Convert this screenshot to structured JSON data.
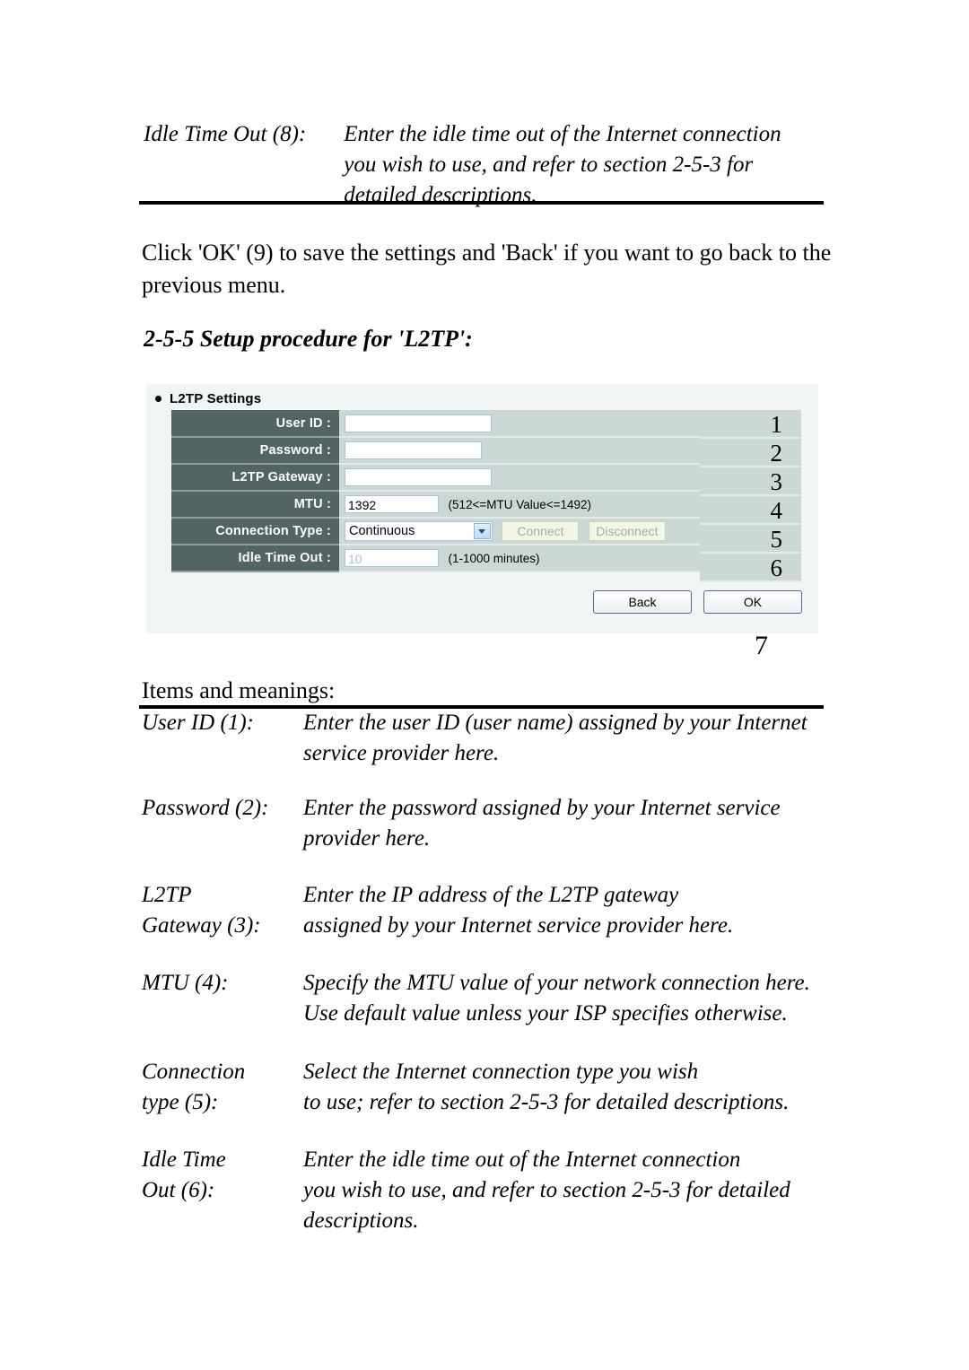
{
  "top_definition": {
    "term": "Idle Time Out (8):",
    "desc_lines": [
      "Enter the idle time out of the Internet connection",
      "you wish to use, and refer to section 2-5-3 for",
      "detailed descriptions."
    ]
  },
  "paragraph": {
    "lines": [
      "Click 'OK' (9) to save the settings and 'Back' if you want to go back to the",
      "previous menu."
    ]
  },
  "heading": "2-5-5 Setup procedure for 'L2TP':",
  "panel": {
    "title": "L2TP Settings",
    "rows": [
      {
        "label": "User ID :",
        "control": "text",
        "value": "",
        "hint": "",
        "annotation": "1"
      },
      {
        "label": "Password :",
        "control": "text",
        "value": "",
        "hint": "",
        "annotation": "2"
      },
      {
        "label": "L2TP Gateway :",
        "control": "text",
        "value": "",
        "hint": "",
        "annotation": "3"
      },
      {
        "label": "MTU :",
        "control": "text",
        "value": "1392",
        "hint": "(512<=MTU Value<=1492)",
        "annotation": "4"
      },
      {
        "label": "Connection Type :",
        "control": "select",
        "value": "Continuous",
        "hint": "",
        "annotation": "5"
      },
      {
        "label": "Idle Time Out :",
        "control": "text",
        "value": "10",
        "hint": "(1-1000 minutes)",
        "annotation": "6"
      }
    ],
    "connect_button": "Connect",
    "disconnect_button": "Disconnect",
    "back_button": "Back",
    "ok_button": "OK",
    "outside_annotation": "7",
    "colors": {
      "panel_background": "#f1f5f6",
      "label_cell": "#526562",
      "field_row": "#ccd8d6",
      "input_border": "#a9c6de",
      "dropdown_arrow": "#13509c",
      "disabled_button_text": "#a6aea2"
    }
  },
  "items_label": "Items and meanings:",
  "definitions": [
    {
      "term_lines": [
        "User ID (1):"
      ],
      "desc_lines": [
        "Enter the user ID (user name) assigned by your Internet",
        "service provider here."
      ]
    },
    {
      "term_lines": [
        "Password (2):"
      ],
      "desc_lines": [
        "Enter the password assigned by your Internet service",
        "provider here."
      ]
    },
    {
      "term_lines": [
        "L2TP",
        "Gateway (3):"
      ],
      "desc_lines": [
        "Enter the IP address of the L2TP gateway",
        "assigned by your Internet service provider here."
      ]
    },
    {
      "term_lines": [
        "MTU (4):"
      ],
      "desc_lines": [
        "Specify the MTU value of your network connection here.",
        "Use default value unless your ISP specifies otherwise."
      ]
    },
    {
      "term_lines": [
        "Connection",
        "type (5):"
      ],
      "desc_lines": [
        "Select the Internet connection type you wish",
        "to use; refer to section 2-5-3 for detailed descriptions."
      ]
    },
    {
      "term_lines": [
        "Idle Time",
        "Out (6):"
      ],
      "desc_lines": [
        "Enter the idle time out of the Internet connection",
        "you wish to use, and refer to section 2-5-3 for detailed",
        "descriptions."
      ]
    }
  ]
}
